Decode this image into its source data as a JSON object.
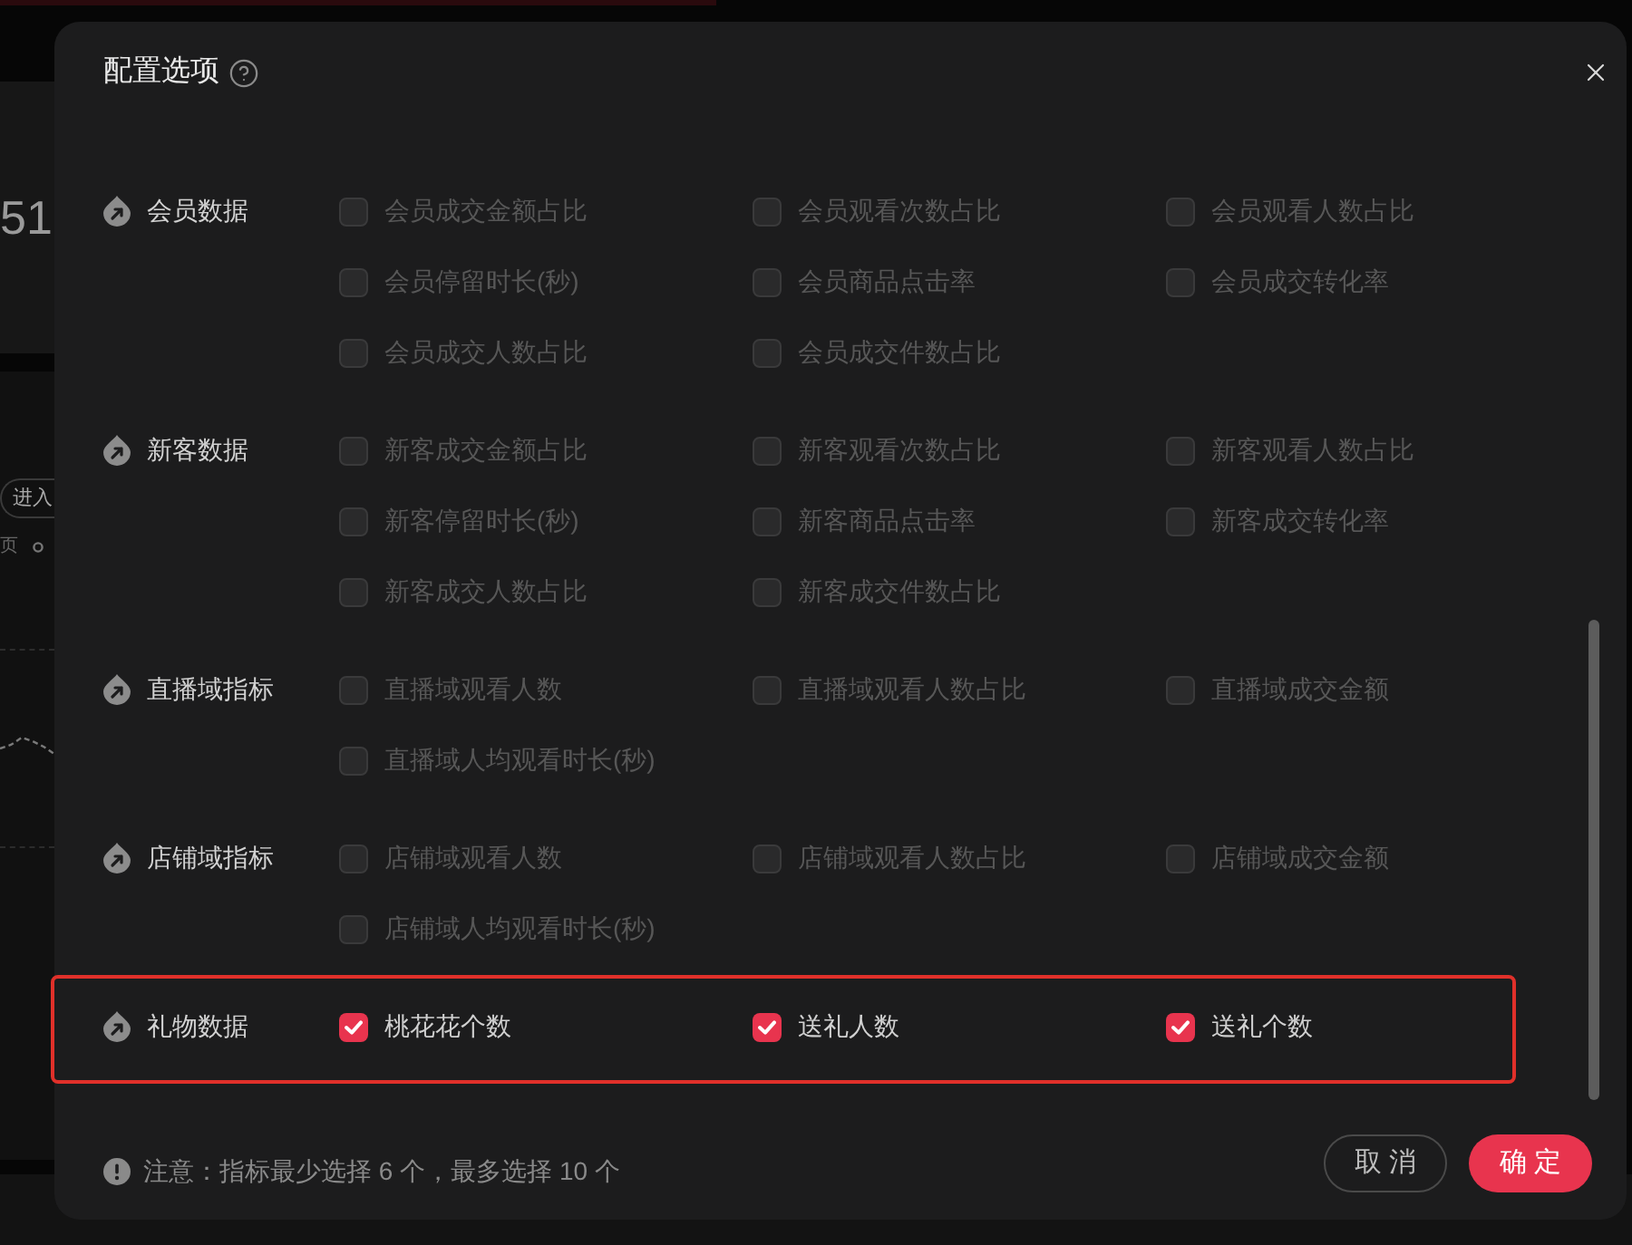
{
  "background": {
    "stat_value": "51",
    "button": "进入",
    "legend": "页"
  },
  "dialog": {
    "title": "配置选项",
    "sections": [
      {
        "title": "会员数据",
        "highlighted": false,
        "items": [
          {
            "label": "会员成交金额占比",
            "checked": false
          },
          {
            "label": "会员观看次数占比",
            "checked": false
          },
          {
            "label": "会员观看人数占比",
            "checked": false
          },
          {
            "label": "会员停留时长(秒)",
            "checked": false
          },
          {
            "label": "会员商品点击率",
            "checked": false
          },
          {
            "label": "会员成交转化率",
            "checked": false
          },
          {
            "label": "会员成交人数占比",
            "checked": false
          },
          {
            "label": "会员成交件数占比",
            "checked": false
          }
        ]
      },
      {
        "title": "新客数据",
        "highlighted": false,
        "items": [
          {
            "label": "新客成交金额占比",
            "checked": false
          },
          {
            "label": "新客观看次数占比",
            "checked": false
          },
          {
            "label": "新客观看人数占比",
            "checked": false
          },
          {
            "label": "新客停留时长(秒)",
            "checked": false
          },
          {
            "label": "新客商品点击率",
            "checked": false
          },
          {
            "label": "新客成交转化率",
            "checked": false
          },
          {
            "label": "新客成交人数占比",
            "checked": false
          },
          {
            "label": "新客成交件数占比",
            "checked": false
          }
        ]
      },
      {
        "title": "直播域指标",
        "highlighted": false,
        "items": [
          {
            "label": "直播域观看人数",
            "checked": false
          },
          {
            "label": "直播域观看人数占比",
            "checked": false
          },
          {
            "label": "直播域成交金额",
            "checked": false
          },
          {
            "label": "直播域人均观看时长(秒)",
            "checked": false
          }
        ]
      },
      {
        "title": "店铺域指标",
        "highlighted": false,
        "items": [
          {
            "label": "店铺域观看人数",
            "checked": false
          },
          {
            "label": "店铺域观看人数占比",
            "checked": false
          },
          {
            "label": "店铺域成交金额",
            "checked": false
          },
          {
            "label": "店铺域人均观看时长(秒)",
            "checked": false
          }
        ]
      },
      {
        "title": "礼物数据",
        "highlighted": true,
        "items": [
          {
            "label": "桃花花个数",
            "checked": true
          },
          {
            "label": "送礼人数",
            "checked": true
          },
          {
            "label": "送礼个数",
            "checked": true
          }
        ]
      }
    ],
    "note": "注意：指标最少选择 6 个，最多选择 10 个",
    "buttons": [
      {
        "label": "取 消",
        "kind": "secondary"
      },
      {
        "label": "确 定",
        "kind": "primary"
      }
    ]
  }
}
